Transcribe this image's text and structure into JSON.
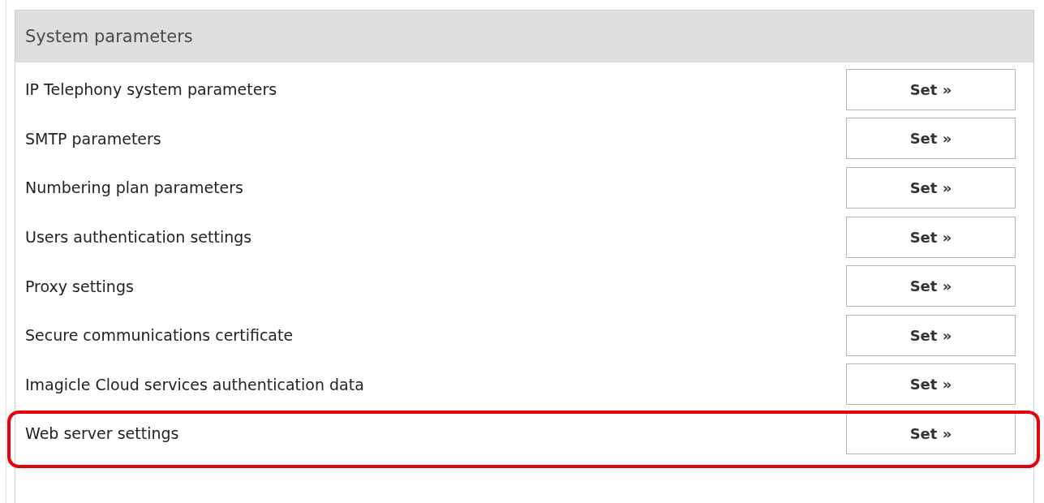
{
  "panel": {
    "title": "System parameters",
    "rows": [
      {
        "label": "IP Telephony system parameters",
        "button": "Set »",
        "highlighted": false
      },
      {
        "label": "SMTP parameters",
        "button": "Set »",
        "highlighted": false
      },
      {
        "label": "Numbering plan parameters",
        "button": "Set »",
        "highlighted": false
      },
      {
        "label": "Users authentication settings",
        "button": "Set »",
        "highlighted": false
      },
      {
        "label": "Proxy settings",
        "button": "Set »",
        "highlighted": false
      },
      {
        "label": "Secure communications certificate",
        "button": "Set »",
        "highlighted": false
      },
      {
        "label": "Imagicle Cloud services authentication data",
        "button": "Set »",
        "highlighted": false
      },
      {
        "label": "Web server settings",
        "button": "Set »",
        "highlighted": true
      }
    ]
  }
}
